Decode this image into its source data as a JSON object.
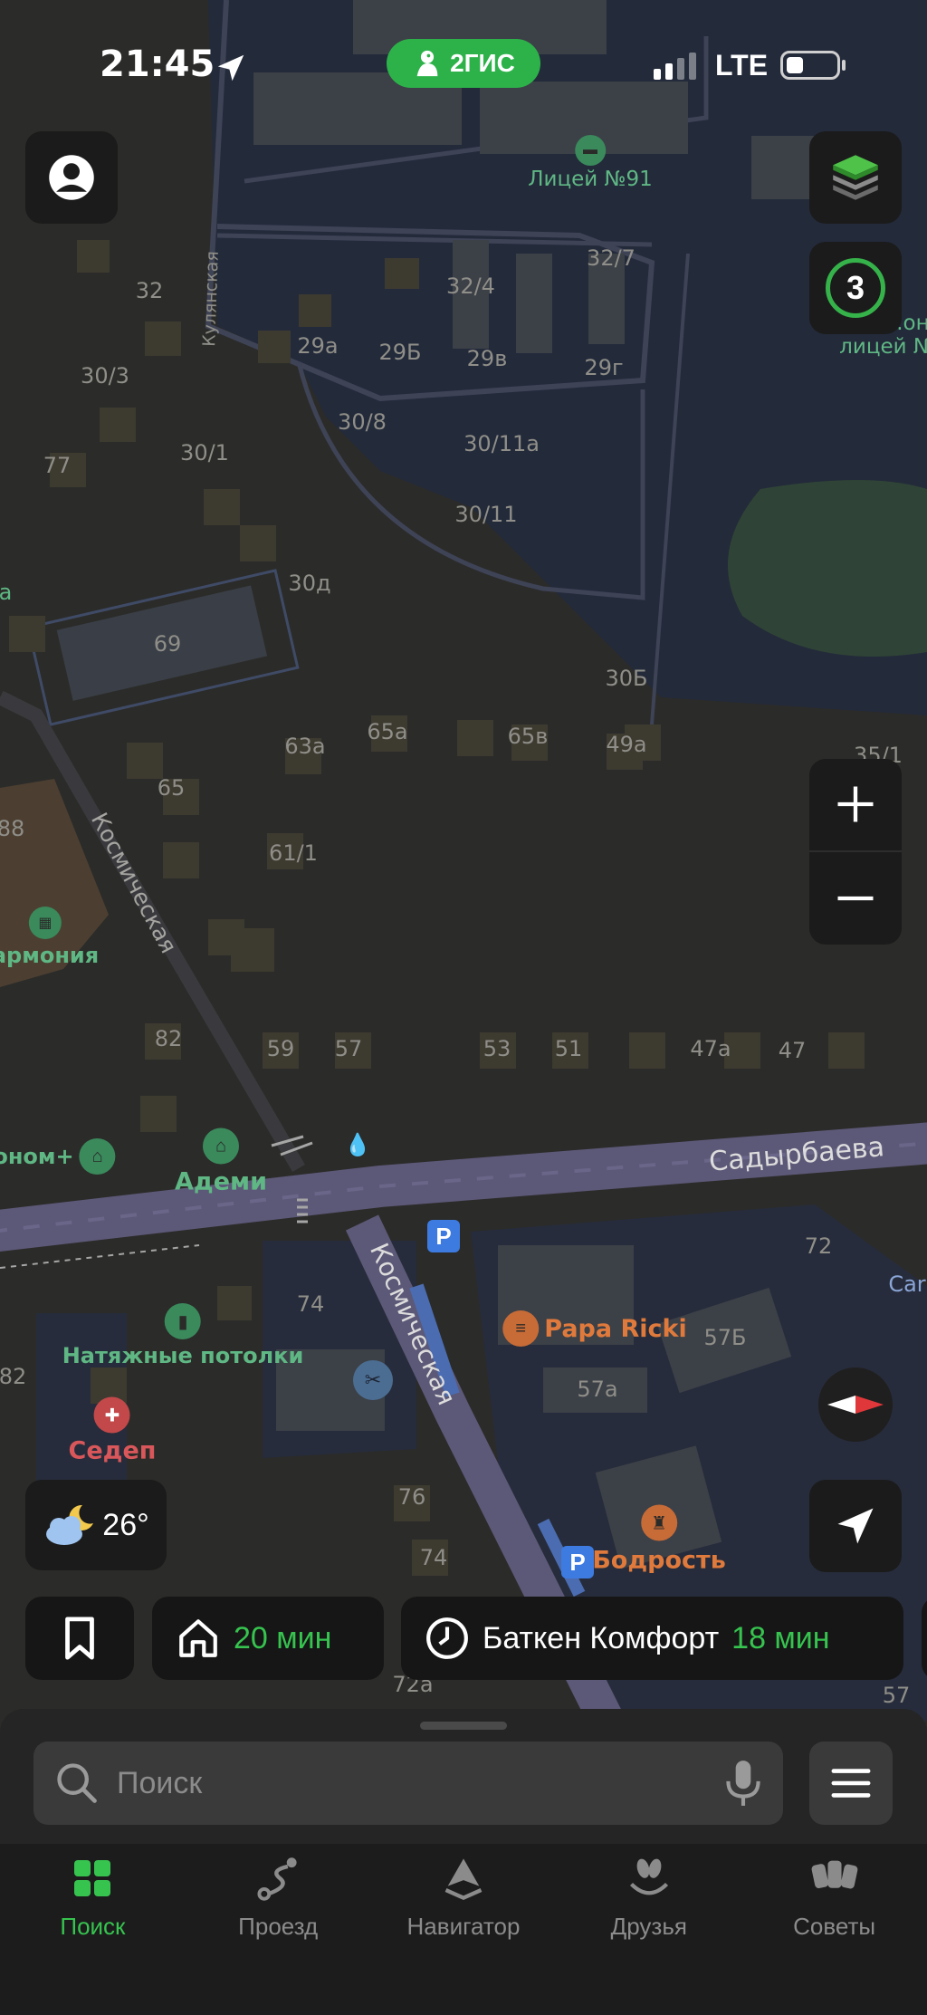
{
  "status_bar": {
    "time": "21:45",
    "network": "LTE"
  },
  "brand": {
    "name": "2ГИС"
  },
  "map": {
    "street_labels": [
      {
        "text": "Кулянская"
      },
      {
        "text": "Космическая"
      },
      {
        "text": "Садырбаева"
      },
      {
        "text": "Космическая"
      }
    ],
    "house_numbers": [
      "32",
      "30/3",
      "77",
      "30/1",
      "29а",
      "29Б",
      "29в",
      "29г",
      "32/4",
      "32/7",
      "30/8",
      "30/11а",
      "30/11",
      "30д",
      "69",
      "30Б",
      "63а",
      "65а",
      "65в",
      "49а",
      "35/1",
      "65",
      "88",
      "61/1",
      "82",
      "59",
      "57",
      "53",
      "51",
      "47а",
      "47",
      "72",
      "74",
      "57Б",
      "57а",
      "82",
      "76",
      "74",
      "72а",
      "57",
      "а",
      "Car"
    ],
    "pois": [
      {
        "name": "Лицей №91",
        "color": "green"
      },
      {
        "name": "Гру...он",
        "color": "green"
      },
      {
        "name": "лицей №",
        "color": "green"
      },
      {
        "name": "армония",
        "color": "green"
      },
      {
        "name": "Адеми",
        "color": "green"
      },
      {
        "name": "оном+",
        "color": "green"
      },
      {
        "name": "Натяжные потолки",
        "color": "green"
      },
      {
        "name": "Седеп",
        "color": "red"
      },
      {
        "name": "Papa Ricki",
        "color": "orange"
      },
      {
        "name": "Бодрость",
        "color": "orange"
      }
    ],
    "parking_label": "P"
  },
  "controls": {
    "traffic_level": "3",
    "weather_temp": "26°"
  },
  "shortcuts": {
    "home_eta": "20 мин",
    "work_name": "Баткен Комфорт",
    "work_eta": "18 мин"
  },
  "search": {
    "placeholder": "Поиск"
  },
  "tabs": [
    {
      "label": "Поиск",
      "icon": "grid-icon",
      "active": true
    },
    {
      "label": "Проезд",
      "icon": "route-icon",
      "active": false
    },
    {
      "label": "Навигатор",
      "icon": "navigator-icon",
      "active": false
    },
    {
      "label": "Друзья",
      "icon": "friends-icon",
      "active": false
    },
    {
      "label": "Советы",
      "icon": "tips-icon",
      "active": false
    }
  ],
  "colors": {
    "accent_green": "#36C44F",
    "brand_green": "#2DB24A",
    "poi_green": "#5FB784",
    "poi_orange": "#E07A3C",
    "poi_red": "#D9575A",
    "road_purple": "#5D5A7C"
  }
}
